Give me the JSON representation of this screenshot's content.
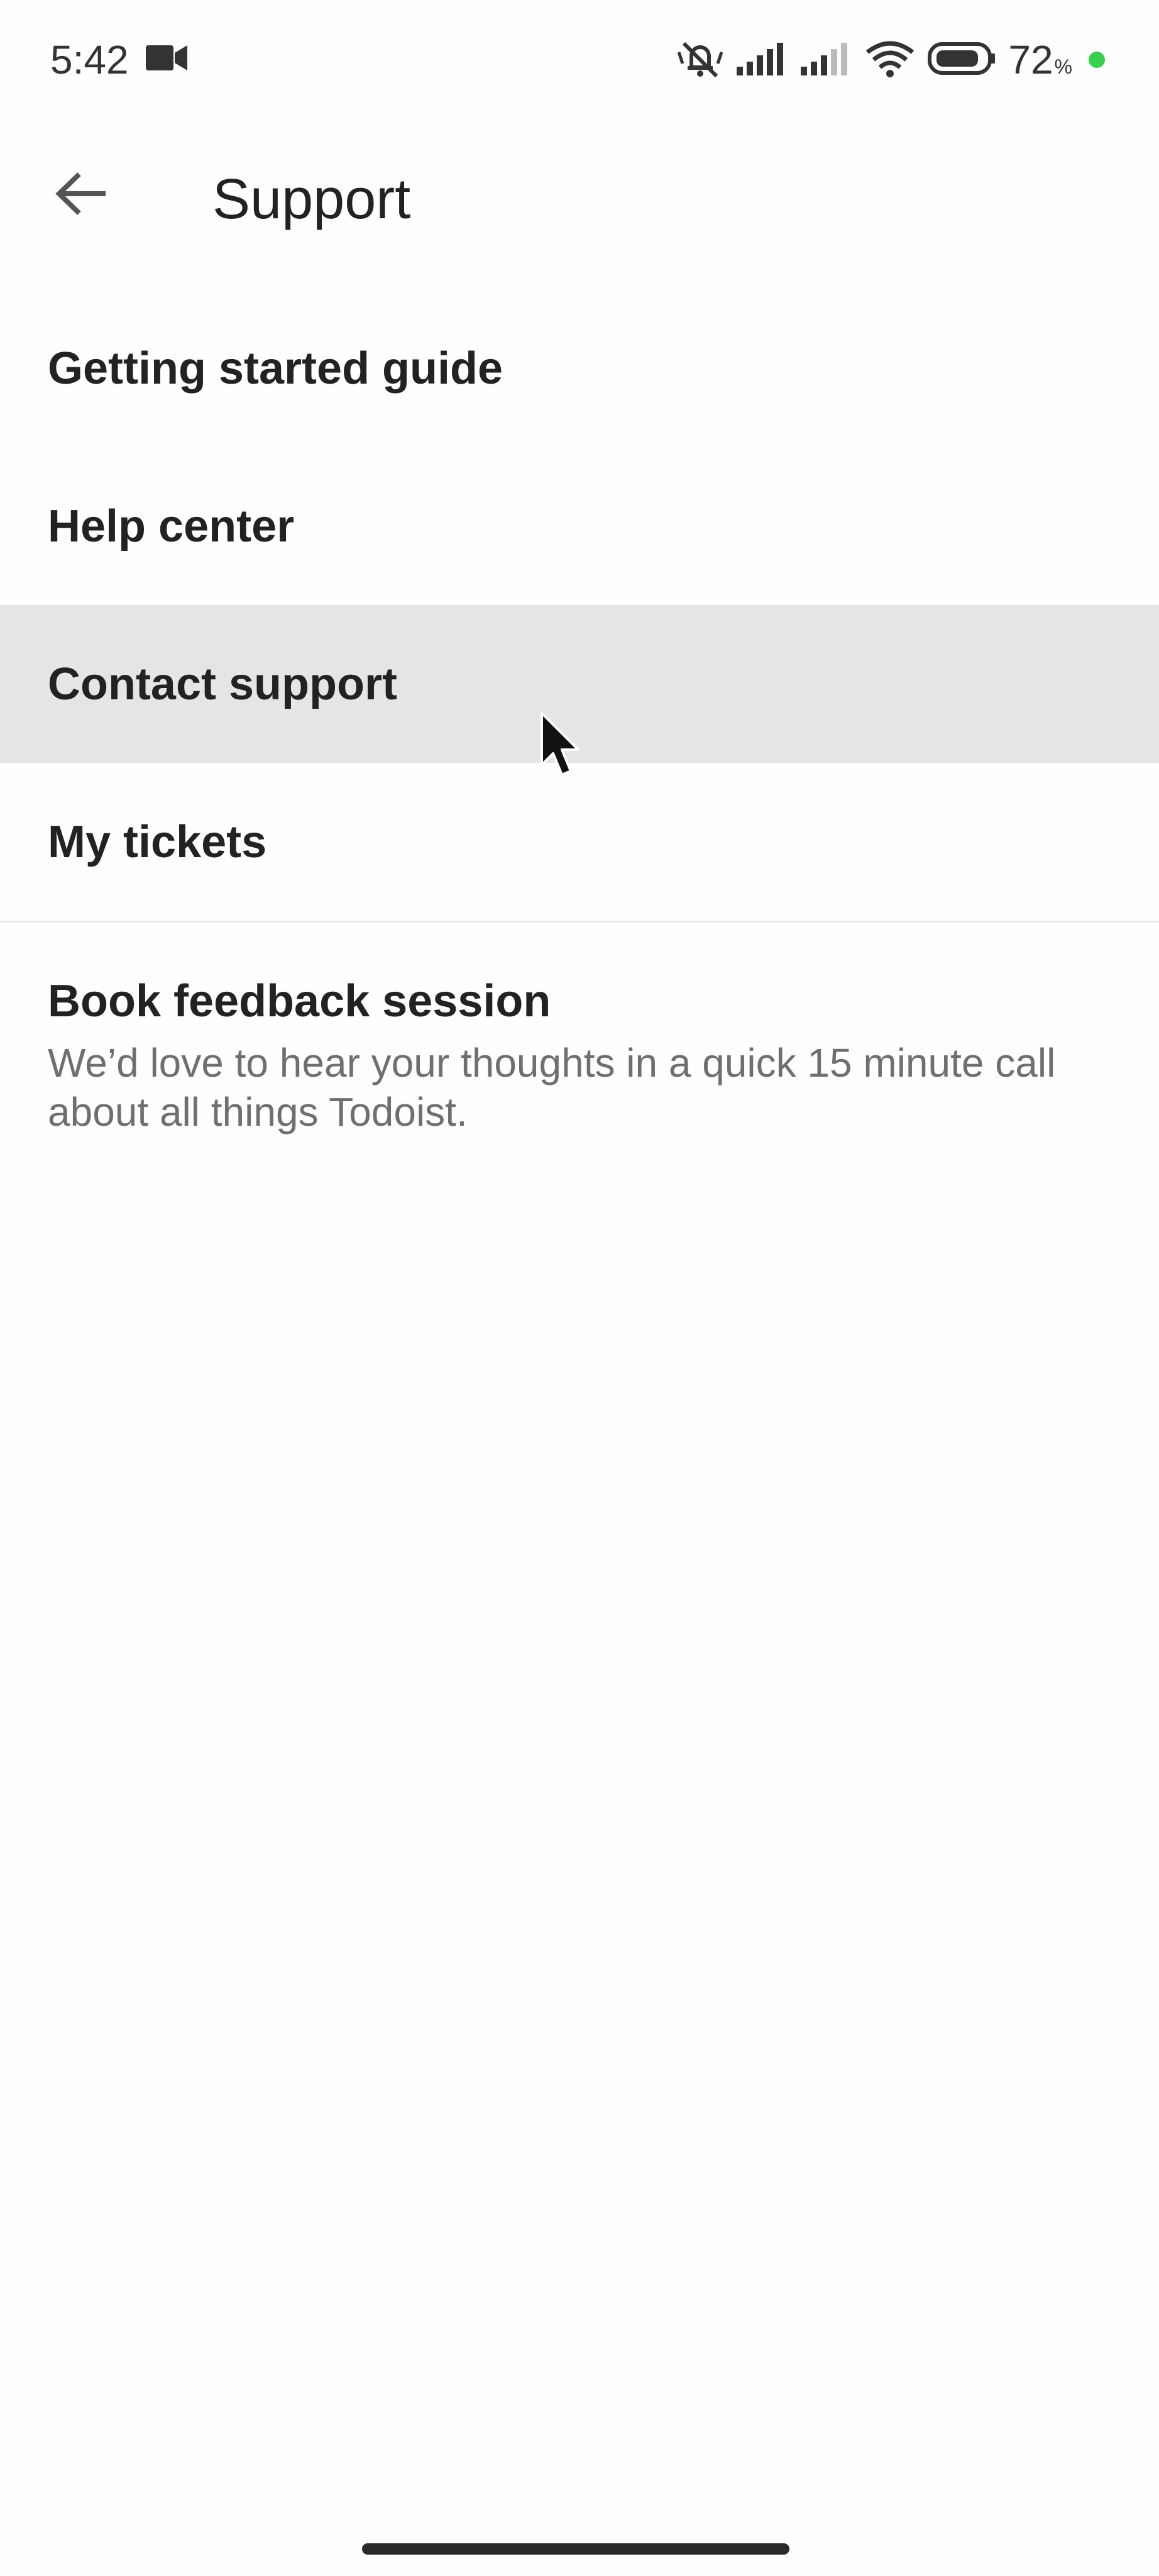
{
  "status_bar": {
    "time": "5:42",
    "battery_value": "72",
    "battery_unit": "%",
    "icons": [
      "video-camera-icon",
      "silent-bell-icon",
      "signal-icon",
      "signal-icon",
      "wifi-icon",
      "battery-icon",
      "green-dot"
    ]
  },
  "header": {
    "title": "Support",
    "back_icon": "arrow-left-icon"
  },
  "menu": {
    "items": [
      {
        "label": "Getting started guide"
      },
      {
        "label": "Help center"
      },
      {
        "label": "Contact support",
        "highlighted": true
      },
      {
        "label": "My tickets"
      },
      {
        "label": "Book feedback session",
        "subtitle": "We’d love to hear your thoughts in a quick 15 minute call about all things Todoist."
      }
    ]
  },
  "colors": {
    "background": "#fefefe",
    "highlight": "#e5e5e5",
    "text_primary": "#222222",
    "text_secondary": "#6f6f6f",
    "indicator_dot": "#35d04e"
  }
}
